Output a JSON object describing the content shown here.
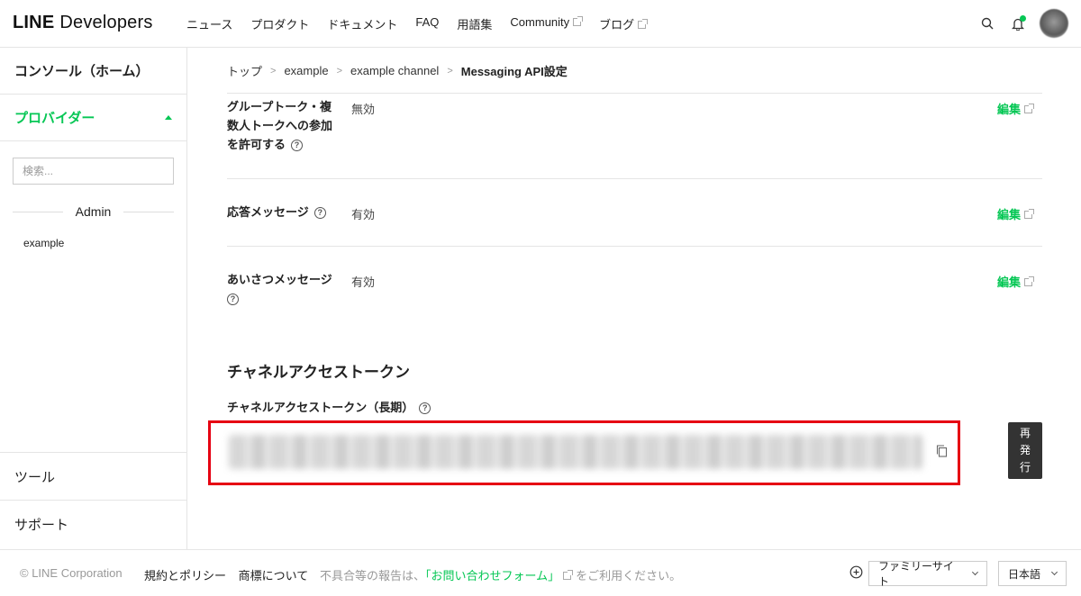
{
  "header": {
    "logo_line": "LINE",
    "logo_dev": "Developers",
    "nav": [
      {
        "label": "ニュース"
      },
      {
        "label": "プロダクト"
      },
      {
        "label": "ドキュメント"
      },
      {
        "label": "FAQ"
      },
      {
        "label": "用語集"
      },
      {
        "label": "Community"
      },
      {
        "label": "ブログ"
      }
    ],
    "accent": "#06c755"
  },
  "sidebar": {
    "console": "コンソール（ホーム）",
    "providers": "プロバイダー",
    "search_placeholder": "検索...",
    "group": "Admin",
    "item": "example",
    "tools": "ツール",
    "support": "サポート"
  },
  "breadcrumb": {
    "items": [
      "トップ",
      "example",
      "example channel"
    ],
    "current": "Messaging API設定"
  },
  "settings": {
    "group_talk_label": "グループトーク・複数人トークへの参加を許可する",
    "group_talk_value": "無効",
    "auto_reply_label": "応答メッセージ",
    "auto_reply_value": "有効",
    "greeting_label": "あいさつメッセージ",
    "greeting_value": "有効",
    "edit_label": "編集"
  },
  "token": {
    "section_title": "チャネルアクセストークン",
    "sub_title": "チャネルアクセストークン（長期）",
    "reissue_label": "再発行",
    "highlight_color": "#e60012"
  },
  "footer": {
    "copyright": "© LINE Corporation",
    "terms": "規約とポリシー",
    "trademark": "商標について",
    "note_prefix": "不具合等の報告は、",
    "note_link": "「お問い合わせフォーム」",
    "note_suffix": "をご利用ください。",
    "family_site": "ファミリーサイト",
    "language": "日本語"
  }
}
